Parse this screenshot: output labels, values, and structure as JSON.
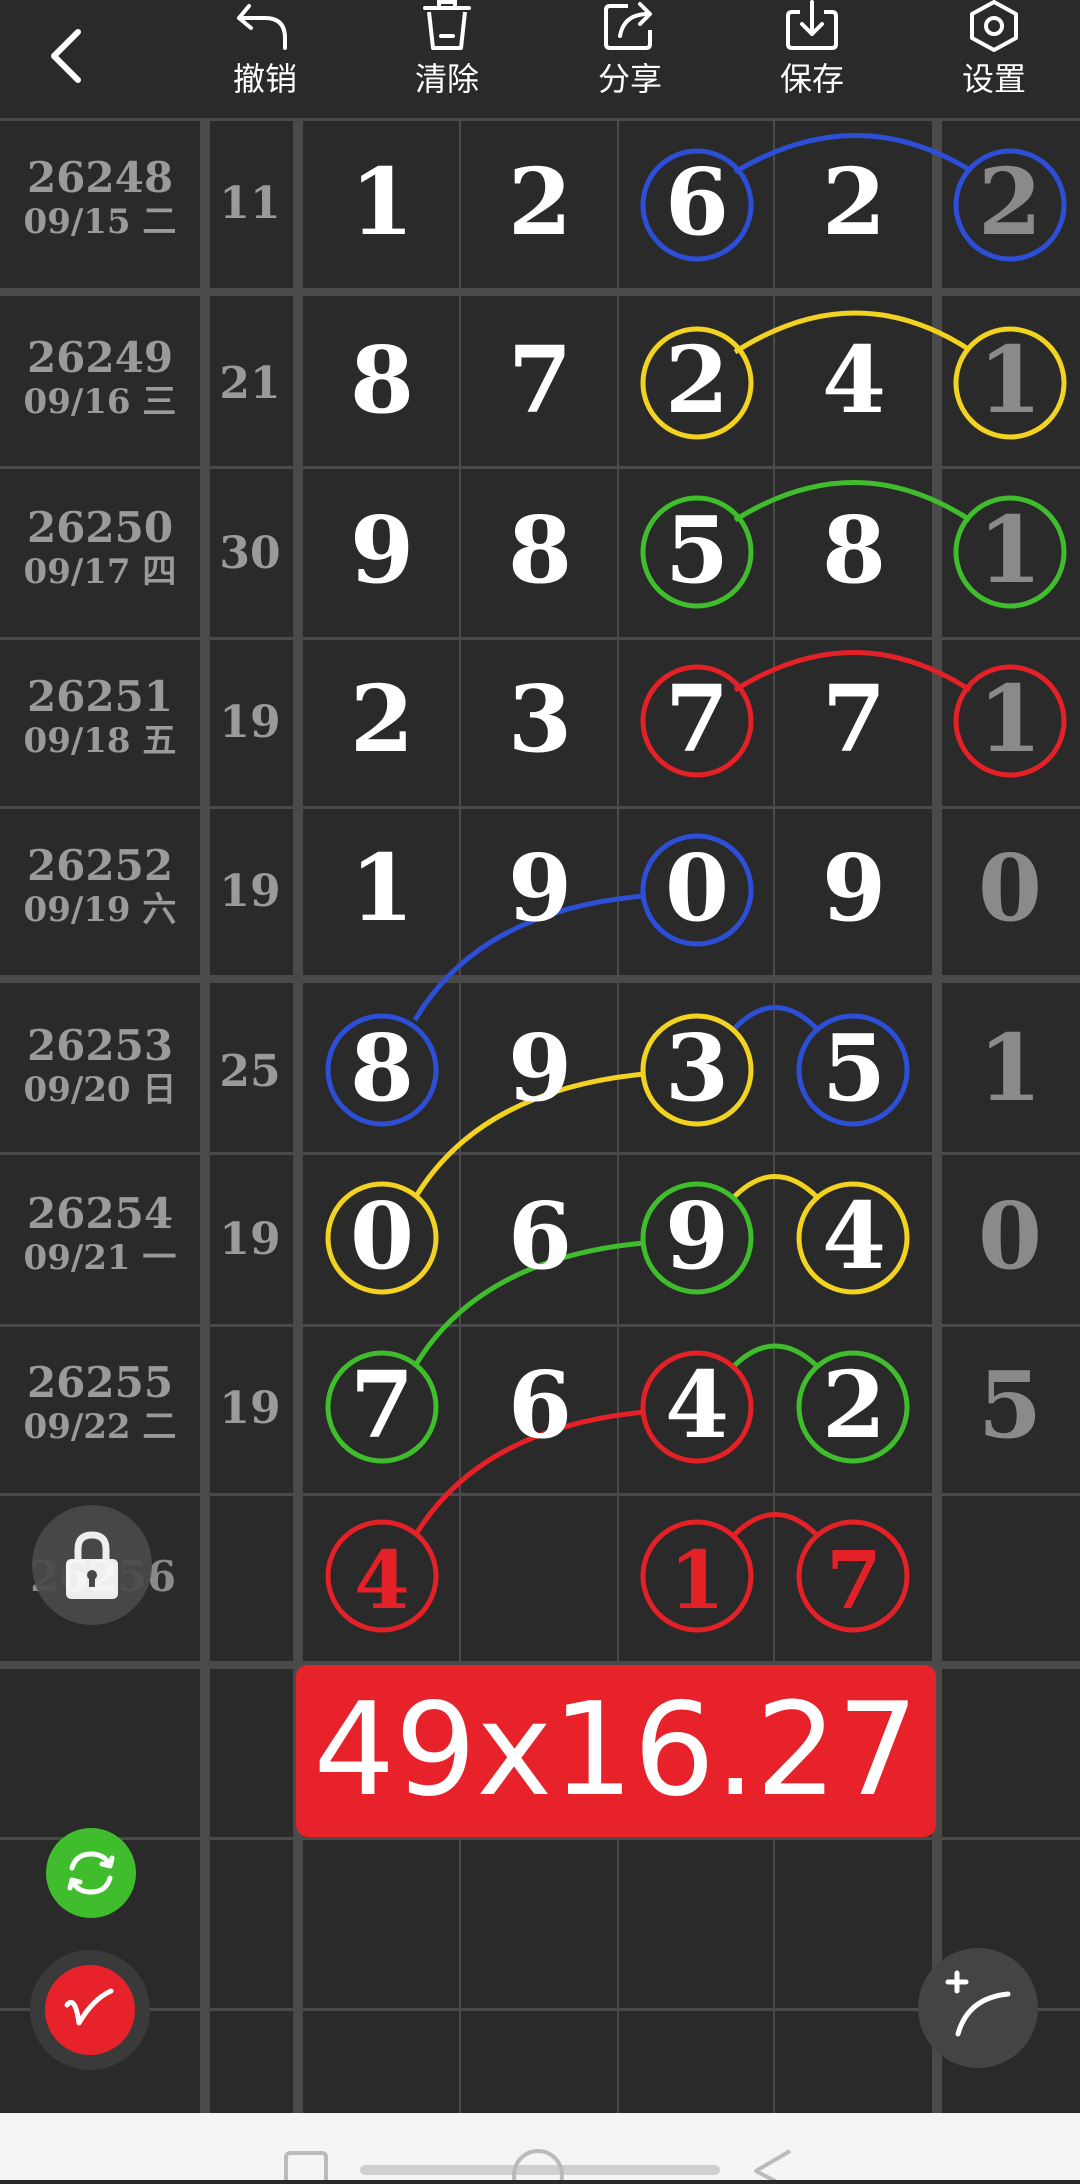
{
  "toolbar": {
    "undo_label": "撤销",
    "clear_label": "清除",
    "share_label": "分享",
    "save_label": "保存",
    "settings_label": "设置"
  },
  "rows": [
    {
      "issue": "26248",
      "date": "09/15 二",
      "sum": "11",
      "d1": "1",
      "d2": "2",
      "d3": "6",
      "d4": "2",
      "d5": "2"
    },
    {
      "issue": "26249",
      "date": "09/16 三",
      "sum": "21",
      "d1": "8",
      "d2": "7",
      "d3": "2",
      "d4": "4",
      "d5": "1"
    },
    {
      "issue": "26250",
      "date": "09/17 四",
      "sum": "30",
      "d1": "9",
      "d2": "8",
      "d3": "5",
      "d4": "8",
      "d5": "1"
    },
    {
      "issue": "26251",
      "date": "09/18 五",
      "sum": "19",
      "d1": "2",
      "d2": "3",
      "d3": "7",
      "d4": "7",
      "d5": "1"
    },
    {
      "issue": "26252",
      "date": "09/19 六",
      "sum": "19",
      "d1": "1",
      "d2": "9",
      "d3": "0",
      "d4": "9",
      "d5": "0"
    },
    {
      "issue": "26253",
      "date": "09/20 日",
      "sum": "25",
      "d1": "8",
      "d2": "9",
      "d3": "3",
      "d4": "5",
      "d5": "1"
    },
    {
      "issue": "26254",
      "date": "09/21 一",
      "sum": "19",
      "d1": "0",
      "d2": "6",
      "d3": "9",
      "d4": "4",
      "d5": "0"
    },
    {
      "issue": "26255",
      "date": "09/22 二",
      "sum": "19",
      "d1": "7",
      "d2": "6",
      "d3": "4",
      "d4": "2",
      "d5": "5"
    }
  ],
  "next_row": {
    "issue": "26256",
    "p1": "4",
    "p3": "1",
    "p4": "7"
  },
  "result": "49x16.27",
  "colors": {
    "blue": "#2d4fd8",
    "yellow": "#f3d321",
    "green": "#3fbd2c",
    "red": "#e52128",
    "background": "#2a2a2a",
    "grid": "#4a4a4a"
  },
  "icons": [
    "back-arrow-icon",
    "undo-icon",
    "trash-icon",
    "share-icon",
    "save-icon",
    "settings-icon",
    "lock-icon",
    "refresh-icon",
    "pen-icon",
    "draw-line-icon"
  ]
}
